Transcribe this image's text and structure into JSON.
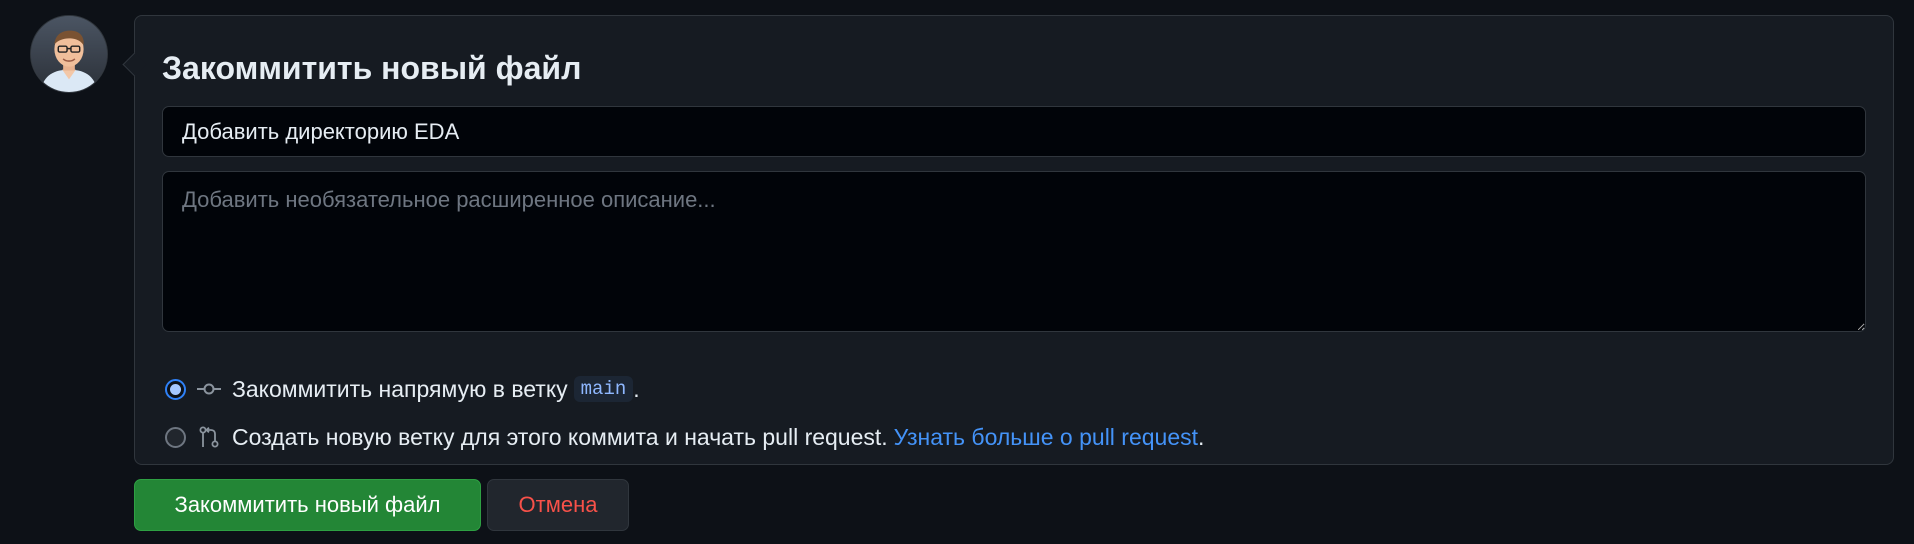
{
  "commit_form": {
    "title": "Закоммитить новый файл",
    "summary_value": "Добавить директорию EDA",
    "description_placeholder": "Добавить необязательное расширенное описание...",
    "option_direct": {
      "label": "Закоммитить напрямую в ветку",
      "branch": "main",
      "suffix": ".",
      "selected": true,
      "icon": "git-commit-icon"
    },
    "option_new_branch": {
      "label": "Создать новую ветку для этого коммита и начать pull request.",
      "link_text": "Узнать больше о pull request",
      "suffix": ".",
      "selected": false,
      "icon": "git-pull-request-icon"
    }
  },
  "buttons": {
    "commit_label": "Закоммитить новый файл",
    "cancel_label": "Отмена"
  },
  "colors": {
    "background": "#0d1117",
    "panel": "#161b22",
    "input_bg": "#010409",
    "border": "#30363d",
    "primary_button": "#238636",
    "danger_text": "#f85149",
    "link": "#4493f8",
    "radio_selected": "#2f81f7"
  }
}
